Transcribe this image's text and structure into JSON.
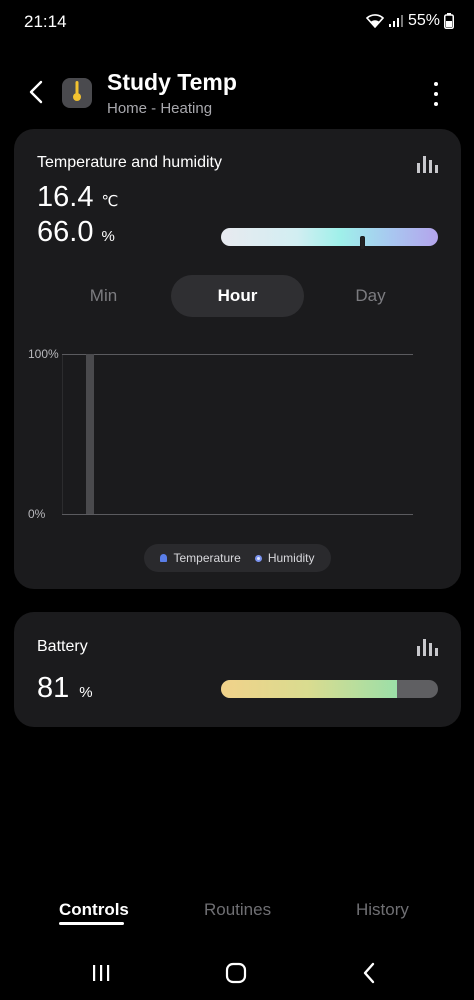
{
  "status_bar": {
    "time": "21:14",
    "battery_percent": "55%"
  },
  "header": {
    "title": "Study Temp",
    "subtitle": "Home - Heating"
  },
  "temp_humidity_card": {
    "title": "Temperature and humidity",
    "temperature_value": "16.4",
    "temperature_unit": "℃",
    "humidity_value": "66.0",
    "humidity_unit": "%",
    "temperature_marker_position": 0.65,
    "range_tabs": [
      {
        "label": "Min",
        "active": false
      },
      {
        "label": "Hour",
        "active": true
      },
      {
        "label": "Day",
        "active": false
      }
    ],
    "chart_data": {
      "type": "bar",
      "title": "",
      "xlabel": "",
      "ylabel": "",
      "ylim": [
        0,
        100
      ],
      "ytick_labels": [
        "100%",
        "0%"
      ],
      "categories": [
        ""
      ],
      "series": [
        {
          "name": "Humidity",
          "values": [
            100
          ]
        }
      ],
      "legend": [
        {
          "label": "Temperature",
          "color": "#5a7ee8",
          "marker": "thermometer"
        },
        {
          "label": "Humidity",
          "color": "#7b93ef",
          "marker": "circle"
        }
      ],
      "legend_placement": "bottom-center",
      "grid": true
    }
  },
  "battery_card": {
    "title": "Battery",
    "value": "81",
    "unit": "%",
    "level_fraction": 0.81
  },
  "bottom_tabs": [
    {
      "label": "Controls",
      "active": true
    },
    {
      "label": "Routines",
      "active": false
    },
    {
      "label": "History",
      "active": false
    }
  ],
  "colors": {
    "background": "#000000",
    "card": "#1b1b1d",
    "accent_temp": "#5a7ee8",
    "device_icon_accent": "#f2c230"
  },
  "icons": [
    "wifi-icon",
    "signal-icon",
    "battery-icon",
    "back-icon",
    "thermometer-icon",
    "more-options-icon",
    "chart-icon",
    "recent-apps-icon",
    "home-icon",
    "system-back-icon"
  ]
}
